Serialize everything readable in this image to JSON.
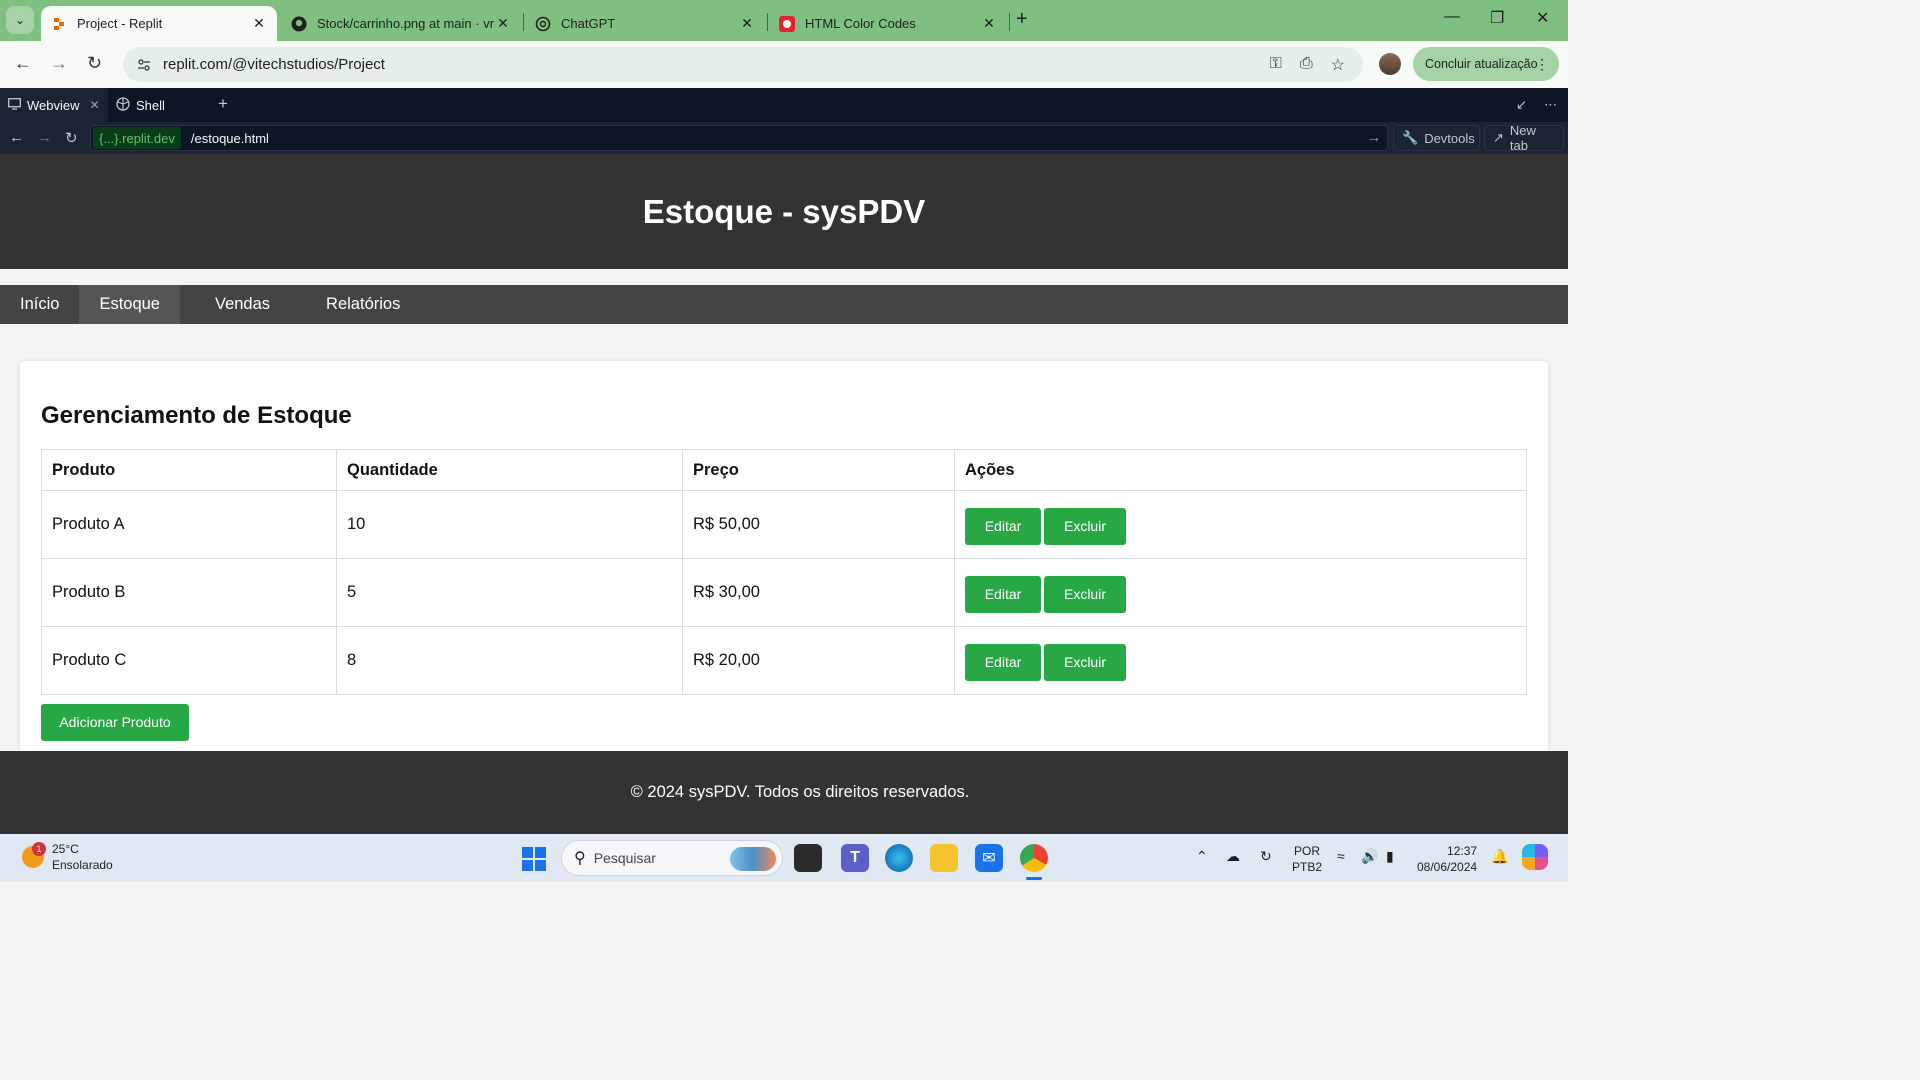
{
  "browser": {
    "tabs": [
      {
        "title": "Project - Replit",
        "active": true
      },
      {
        "title": "Stock/carrinho.png at main · vr",
        "active": false
      },
      {
        "title": "ChatGPT",
        "active": false
      },
      {
        "title": "HTML Color Codes",
        "active": false
      }
    ],
    "address": "replit.com/@vitechstudios/Project",
    "update_button": "Concluir atualização"
  },
  "webview": {
    "tabs": [
      {
        "label": "Webview",
        "active": true
      },
      {
        "label": "Shell",
        "active": false
      }
    ],
    "domain": "{...}.replit.dev",
    "path": "/estoque.html",
    "devtools_label": "Devtools",
    "newtab_label": "New tab"
  },
  "site": {
    "title": "Estoque - sysPDV",
    "nav": [
      {
        "label": "Início",
        "current": false
      },
      {
        "label": "Estoque",
        "current": true
      },
      {
        "label": "Vendas",
        "current": false
      },
      {
        "label": "Relatórios",
        "current": false
      }
    ],
    "section_title": "Gerenciamento de Estoque",
    "table": {
      "headers": [
        "Produto",
        "Quantidade",
        "Preço",
        "Ações"
      ],
      "rows": [
        {
          "produto": "Produto A",
          "quantidade": "10",
          "preco": "R$ 50,00"
        },
        {
          "produto": "Produto B",
          "quantidade": "5",
          "preco": "R$ 30,00"
        },
        {
          "produto": "Produto C",
          "quantidade": "8",
          "preco": "R$ 20,00"
        }
      ],
      "edit_label": "Editar",
      "delete_label": "Excluir"
    },
    "add_button": "Adicionar Produto",
    "footer": "© 2024 sysPDV. Todos os direitos reservados.",
    "colors": {
      "header_bg": "#333333",
      "nav_bg": "#444444",
      "nav_active": "#555555",
      "button": "#28a745"
    }
  },
  "taskbar": {
    "weather_badge": "1",
    "temperature": "25°C",
    "condition": "Ensolarado",
    "search_placeholder": "Pesquisar",
    "language": "POR",
    "layout": "PTB2",
    "time": "12:37",
    "date": "08/06/2024"
  }
}
